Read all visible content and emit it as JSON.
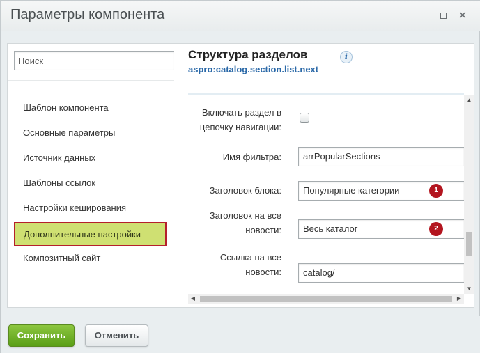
{
  "window": {
    "title": "Параметры компонента",
    "maximize_icon": "maximize-icon",
    "close_icon": "close-icon"
  },
  "sidebar": {
    "search_placeholder": "Поиск",
    "items": [
      {
        "label": "Шаблон компонента",
        "active": false
      },
      {
        "label": "Основные параметры",
        "active": false
      },
      {
        "label": "Источник данных",
        "active": false
      },
      {
        "label": "Шаблоны ссылок",
        "active": false
      },
      {
        "label": "Настройки кеширования",
        "active": false
      },
      {
        "label": "Дополнительные настройки",
        "active": true
      },
      {
        "label": "Композитный сайт",
        "active": false
      }
    ]
  },
  "main": {
    "title": "Структура разделов",
    "subtitle": "aspro:catalog.section.list.next",
    "info_icon": "info-icon",
    "fields": [
      {
        "label_line1": "Включать раздел в",
        "label_line2": "цепочку навигации:",
        "type": "checkbox",
        "checked": false
      },
      {
        "label": "Имя фильтра:",
        "type": "text",
        "value": "arrPopularSections"
      },
      {
        "label": "Заголовок блока:",
        "type": "text",
        "value": "Популярные категории",
        "badge": "1"
      },
      {
        "label_line1": "Заголовок на все",
        "label_line2": "новости:",
        "type": "text",
        "value": "Весь каталог",
        "badge": "2"
      },
      {
        "label_line1": "Ссылка на все",
        "label_line2": "новости:",
        "type": "text",
        "value": "catalog/"
      }
    ]
  },
  "footer": {
    "save_label": "Сохранить",
    "cancel_label": "Отменить"
  },
  "colors": {
    "accent_green": "#6fb02a",
    "active_item_bg": "#cfe072",
    "highlight_border": "#b5202b",
    "badge": "#b3151f",
    "link": "#2b69a8"
  }
}
